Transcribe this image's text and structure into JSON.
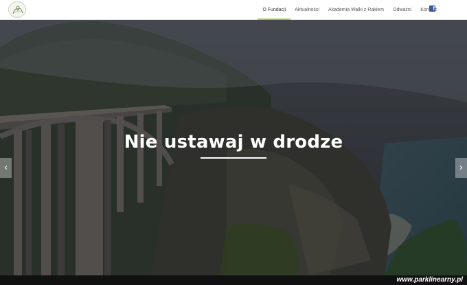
{
  "navbar": {
    "logo_icon": "foundation-logo-icon",
    "menu": [
      {
        "label": "O Fundacji",
        "active": true
      },
      {
        "label": "Aktualności",
        "active": false
      },
      {
        "label": "Akademia Walki z Rakiem",
        "active": false
      },
      {
        "label": "Odważni",
        "active": false
      },
      {
        "label": "Kontakt",
        "active": false
      }
    ],
    "facebook_icon": "facebook-icon",
    "active_color": "#9fc24a"
  },
  "hero": {
    "title": "Nie ustawaj w drodze",
    "prev_icon": "chevron-left-icon",
    "next_icon": "chevron-right-icon",
    "prev_glyph": "‹",
    "next_glyph": "›"
  },
  "watermark": {
    "text": "www.parklinearny.pl"
  }
}
